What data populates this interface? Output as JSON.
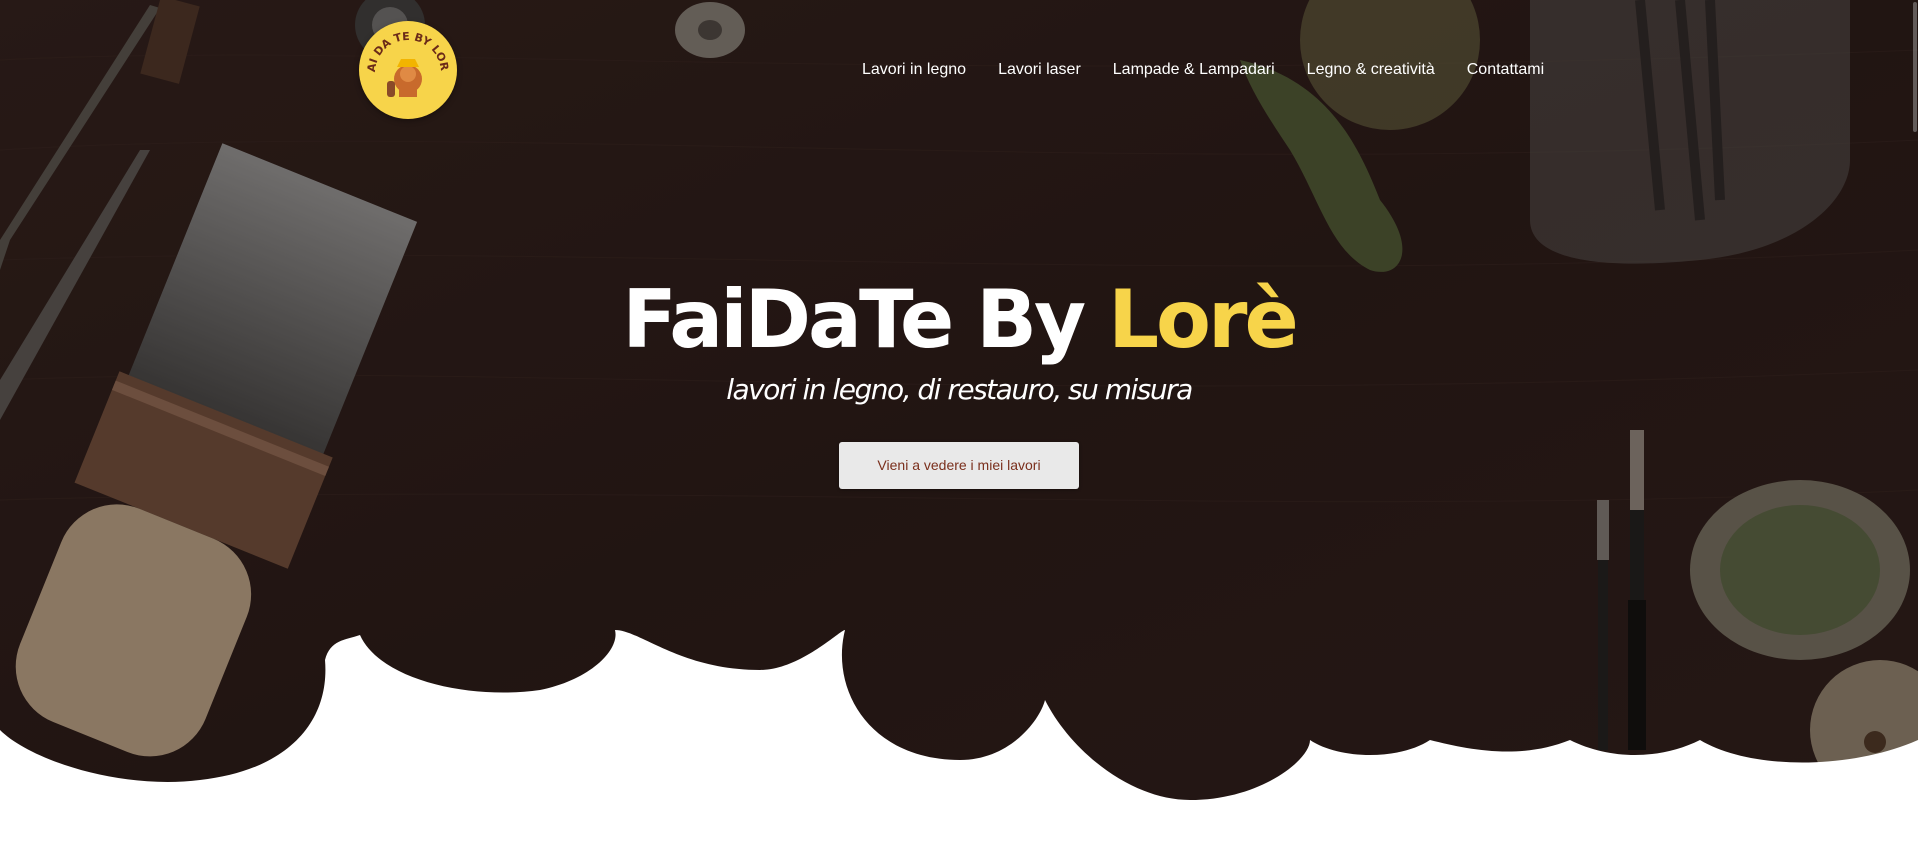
{
  "brand": {
    "logo_text": "FAI DA TE BY LORÈ",
    "colors": {
      "accent_yellow": "#f7d44a",
      "background_dark": "#2a1b18",
      "button_bg": "#e9e9e9",
      "button_text": "#7a2f1c"
    }
  },
  "nav": {
    "items": [
      {
        "label": "Lavori in legno"
      },
      {
        "label": "Lavori laser"
      },
      {
        "label": "Lampade & Lampadari"
      },
      {
        "label": "Legno & creatività"
      },
      {
        "label": "Contattami"
      }
    ]
  },
  "hero": {
    "title_main": "FaiDaTe By ",
    "title_accent": "Lorè",
    "subtitle": "lavori in legno, di restauro, su misura",
    "cta_label": "Vieni a vedere i miei lavori"
  }
}
